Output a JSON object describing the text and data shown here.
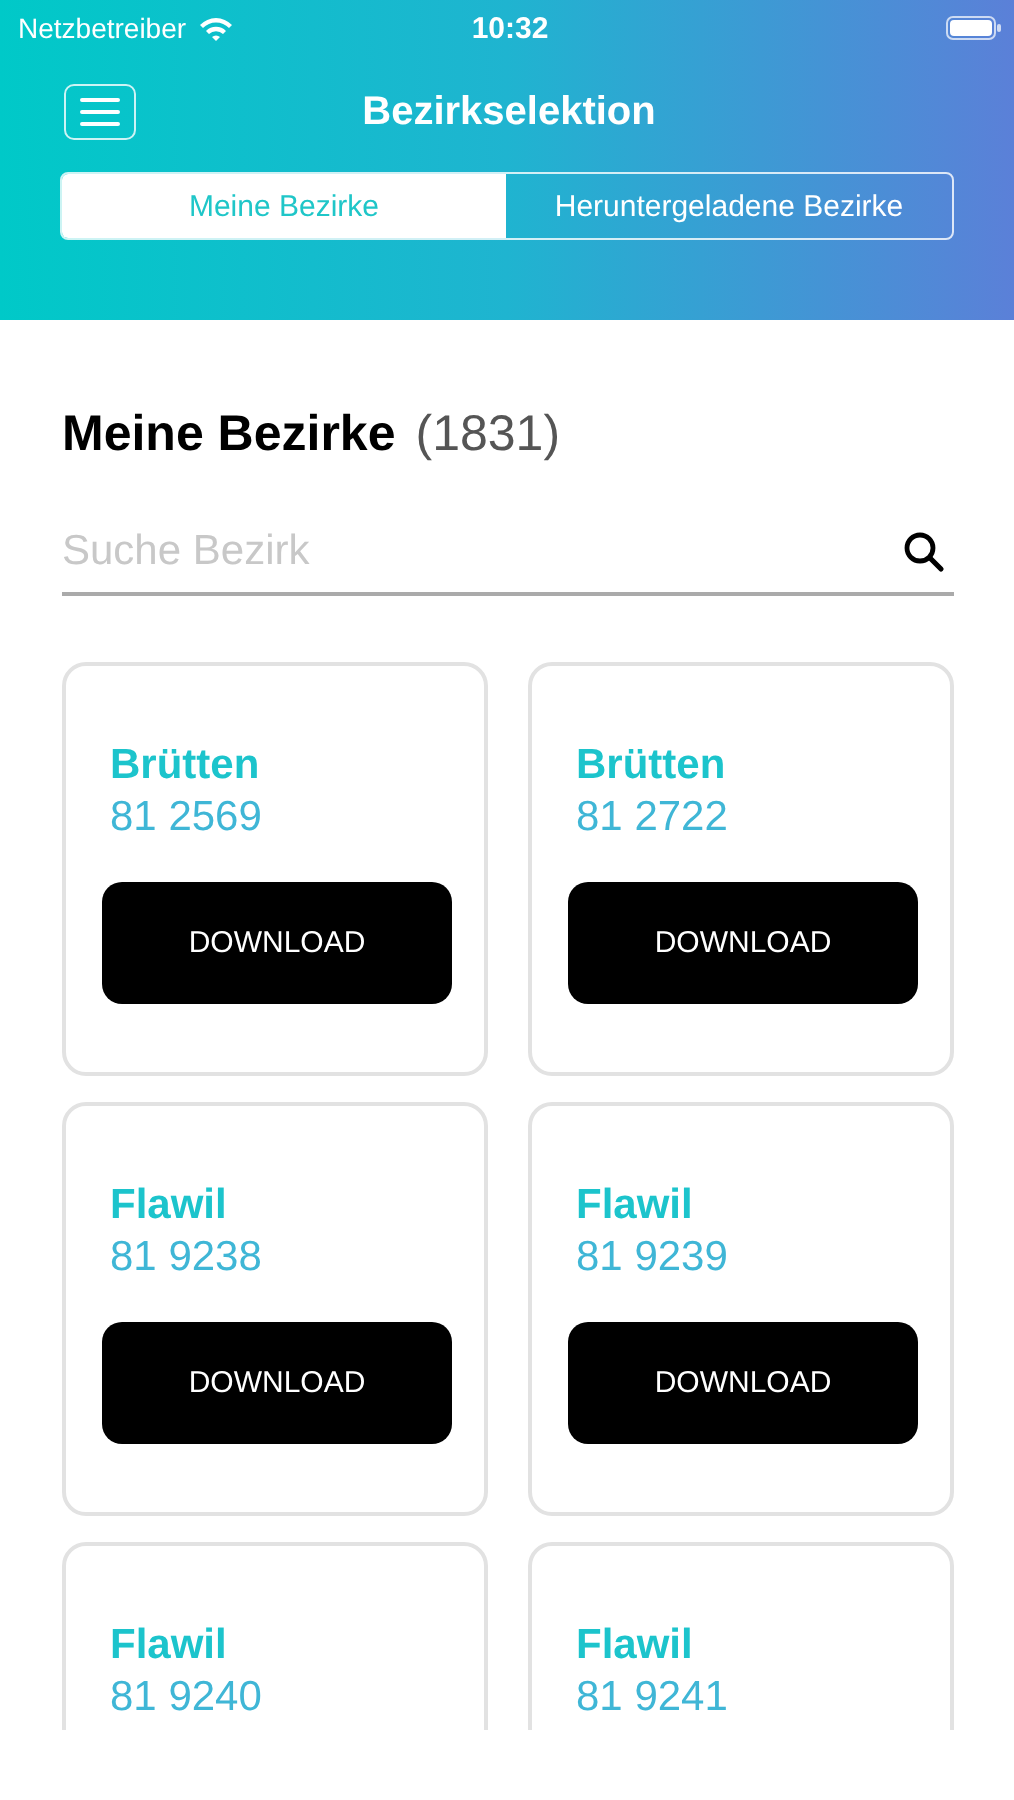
{
  "status_bar": {
    "carrier": "Netzbetreiber",
    "time": "10:32"
  },
  "nav": {
    "title": "Bezirkselektion"
  },
  "tabs": [
    {
      "label": "Meine Bezirke",
      "selected": true
    },
    {
      "label": "Heruntergeladene Bezirke",
      "selected": false
    }
  ],
  "section": {
    "title": "Meine Bezirke",
    "count": "(1831)"
  },
  "search": {
    "placeholder": "Suche Bezirk"
  },
  "districts": [
    {
      "name": "Brütten",
      "code": "81 2569",
      "button": "DOWNLOAD"
    },
    {
      "name": "Brütten",
      "code": "81 2722",
      "button": "DOWNLOAD"
    },
    {
      "name": "Flawil",
      "code": "81 9238",
      "button": "DOWNLOAD"
    },
    {
      "name": "Flawil",
      "code": "81 9239",
      "button": "DOWNLOAD"
    },
    {
      "name": "Flawil",
      "code": "81 9240"
    },
    {
      "name": "Flawil",
      "code": "81 9241"
    }
  ]
}
